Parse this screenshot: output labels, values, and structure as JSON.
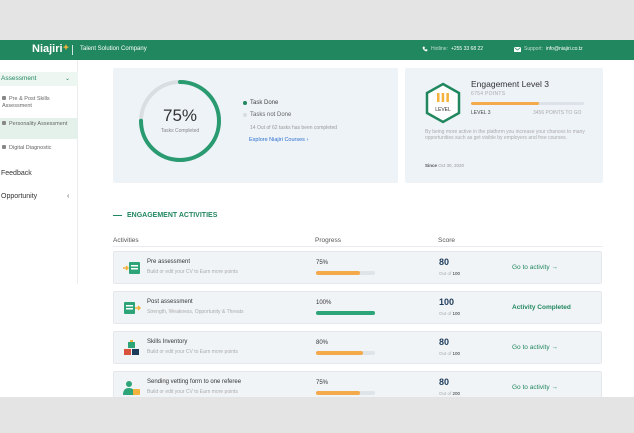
{
  "header": {
    "logo": "Niajiri",
    "company": "Talent Solution Company",
    "hotline_label": "Hotline:",
    "hotline": "+255 33 68 22",
    "support_label": "Support:",
    "support_email": "info@niajiri.co.tz",
    "color": "#21875f"
  },
  "sidebar": {
    "assessment": "Assessment",
    "items": [
      {
        "label": "Pre & Post Skills Assessment"
      },
      {
        "label": "Personality Assessment"
      },
      {
        "label": "Digital Diagnostic"
      }
    ],
    "feedback": "Feedback",
    "opportunity": "Opportunity"
  },
  "progress": {
    "percent": "75%",
    "percent_value": 75,
    "caption": "Tasks Completed",
    "done": "Task Done",
    "not_done": "Tasks not Done",
    "summary": "14 Out of 62 tasks has been completed",
    "explore": "Explore Niajiri Courses"
  },
  "engagement": {
    "title": "Engagement Level 3",
    "points": "6754 POINTS",
    "level": "LEVEL 3",
    "to_go": "3456 POINTS TO GO",
    "hex_label": "LEVEL",
    "bar_fraction": 0.6,
    "desc": "By being more active in the platform you increase your chances to many opportunities such as get visible by employers and free courses.",
    "since_label": "Since",
    "since": "Oct 30, 2020"
  },
  "activities": {
    "section_title": "ENGAGEMENT ACTIVITIES",
    "headers": {
      "activities": "Activities",
      "progress": "Progress",
      "score": "Score"
    },
    "out_of_label": "Out of",
    "rows": [
      {
        "title": "Pre assessment",
        "sub": "Build or edit your CV to Earn more points",
        "progress": "75%",
        "progress_value": 75,
        "bar_color": "#f4a94a",
        "score": "80",
        "out_of": "100",
        "action": "Go to activity",
        "icon": "board-arrow-icon"
      },
      {
        "title": "Post assessment",
        "sub": "Strength, Weakness, Opportunity & Threats",
        "progress": "100%",
        "progress_value": 100,
        "bar_color": "#2ea578",
        "score": "100",
        "out_of": "100",
        "action": "Activity Completed",
        "icon": "board-arrow-right-icon"
      },
      {
        "title": "Skills Inventory",
        "sub": "Build or edit your CV to Earn more points",
        "progress": "80%",
        "progress_value": 80,
        "bar_color": "#f4a94a",
        "score": "80",
        "out_of": "100",
        "action": "Go to activity",
        "icon": "blocks-icon"
      },
      {
        "title": "Sending vetting form to one referee",
        "sub": "Build or edit your CV to Earn more points",
        "progress": "75%",
        "progress_value": 75,
        "bar_color": "#f4a94a",
        "score": "80",
        "out_of": "200",
        "action": "Go to activity",
        "icon": "person-form-icon"
      }
    ]
  }
}
